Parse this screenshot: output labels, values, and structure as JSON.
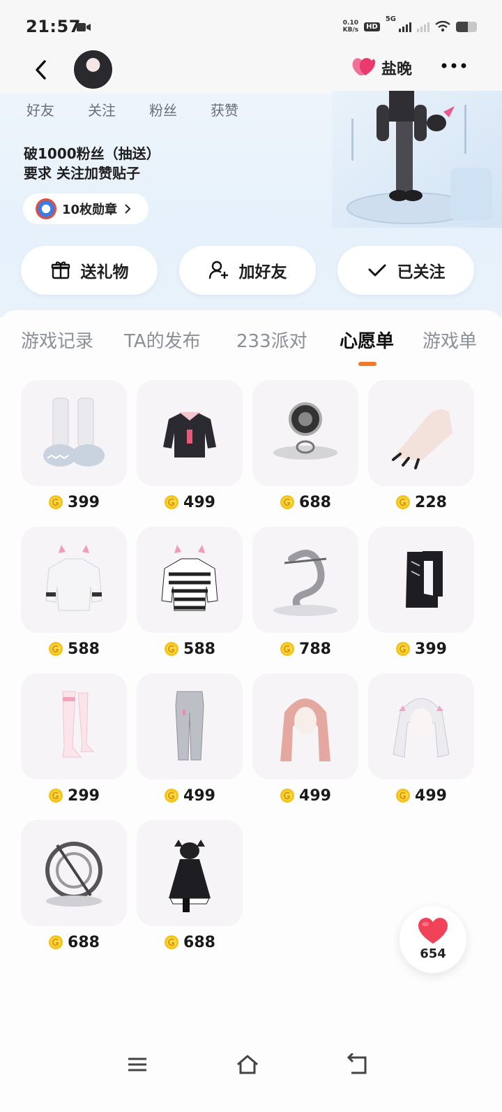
{
  "status_bar": {
    "time": "21:57",
    "net_speed_value": "0.10",
    "net_speed_unit": "KB/s",
    "hd_badge": "HD",
    "network": "5G",
    "battery_level": 0.55
  },
  "nav": {
    "nickname": "盐晚",
    "icons": [
      "back-icon",
      "avatar",
      "heart-icon",
      "more-icon"
    ]
  },
  "profile": {
    "stats": [
      "好友",
      "关注",
      "粉丝",
      "获赞"
    ],
    "bio_line1": "破1000粉丝（抽送）",
    "bio_line2": "要求 关注加赞贴子",
    "medal_label": "10枚勋章"
  },
  "actions": [
    {
      "label": "送礼物",
      "icon": "gift-icon"
    },
    {
      "label": "加好友",
      "icon": "add-friend-icon"
    },
    {
      "label": "已关注",
      "icon": "check-icon"
    }
  ],
  "tabs": [
    {
      "label": "游戏记录",
      "active": false
    },
    {
      "label": "TA的发布",
      "active": false
    },
    {
      "label": "233派对",
      "active": false
    },
    {
      "label": "心愿单",
      "active": true
    },
    {
      "label": "游戏单",
      "active": false
    }
  ],
  "wishlist": [
    {
      "price": "399",
      "icon": "shark-slippers-icon"
    },
    {
      "price": "499",
      "icon": "black-hoodie-icon"
    },
    {
      "price": "688",
      "icon": "silver-halo-icon"
    },
    {
      "price": "228",
      "icon": "nail-hand-icon"
    },
    {
      "price": "588",
      "icon": "white-cat-sweater-icon"
    },
    {
      "price": "588",
      "icon": "striped-cat-sweater-icon"
    },
    {
      "price": "788",
      "icon": "silver-dragon-icon"
    },
    {
      "price": "399",
      "icon": "black-boots-icon"
    },
    {
      "price": "299",
      "icon": "pink-stockings-icon"
    },
    {
      "price": "499",
      "icon": "grey-jeans-icon"
    },
    {
      "price": "499",
      "icon": "pink-hair-icon"
    },
    {
      "price": "499",
      "icon": "white-twintail-hair-icon"
    },
    {
      "price": "688",
      "icon": "silver-ring-halo-icon"
    },
    {
      "price": "688",
      "icon": "gothic-dress-icon"
    }
  ],
  "like_fab": {
    "count": "654",
    "icon": "heart-icon"
  },
  "system_nav": [
    "menu-icon",
    "home-icon",
    "back-nav-icon"
  ],
  "colors": {
    "accent_orange": "#f07a2c",
    "heart_red": "#f0435a",
    "coin_gold": "#f5c21a"
  }
}
